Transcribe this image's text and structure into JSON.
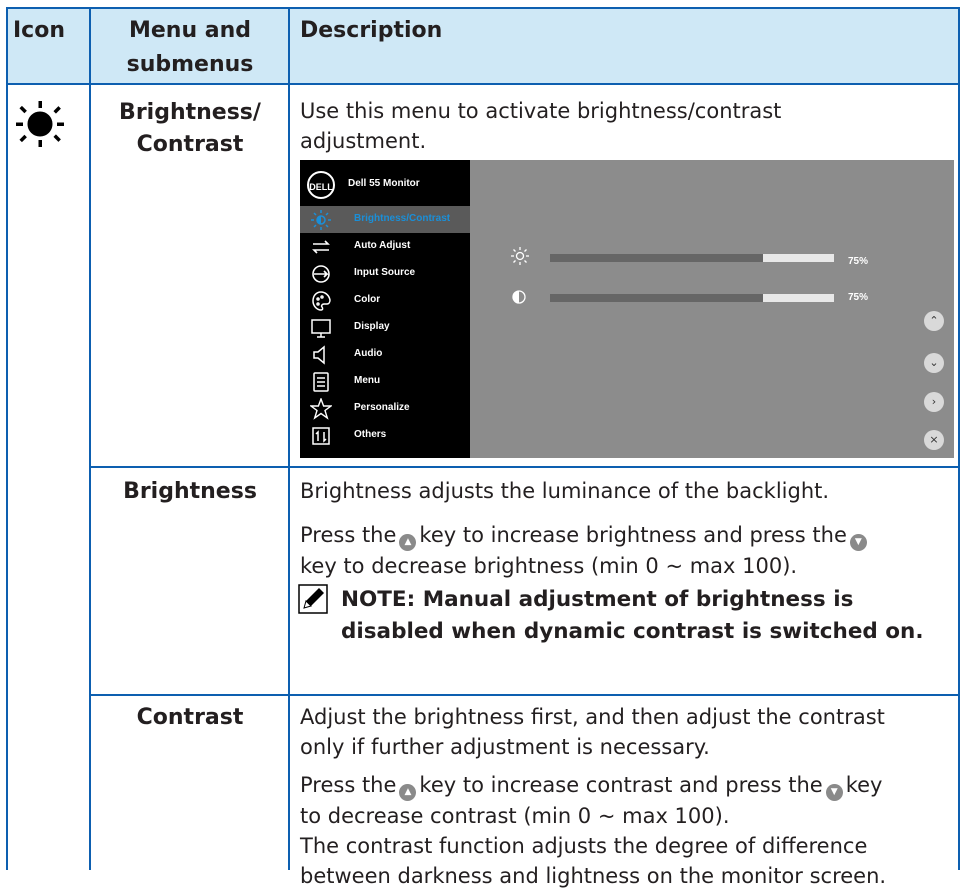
{
  "table": {
    "headers": {
      "icon": "Icon",
      "menu": "Menu and submenus",
      "menu_line1": "Menu and",
      "menu_line2": "submenus",
      "description": "Description"
    },
    "rows": [
      {
        "submenu_line1": "Brightness/",
        "submenu_line2": "Contrast",
        "description_line1": "Use this menu to activate brightness/contrast",
        "description_line2": "adjustment."
      },
      {
        "submenu": "Brightness",
        "para1": "Brightness adjusts the luminance of the backlight.",
        "para2_a": "Press the",
        "para2_b": "key to increase brightness and press the",
        "para2_c": "key to decrease brightness (min 0 ~ max 100).",
        "note_line1": "NOTE: Manual adjustment of brightness is",
        "note_line2": "disabled when dynamic contrast is switched on."
      },
      {
        "submenu": "Contrast",
        "para1_line1": "Adjust the brightness first, and then adjust the contrast",
        "para1_line2": "only if further adjustment is necessary.",
        "para2_a": "Press the",
        "para2_b": "key to increase contrast and press the",
        "para2_c": "key",
        "para2_line2": "to decrease contrast (min 0 ~ max 100).",
        "para3_line1": "The contrast function adjusts the degree of difference",
        "para3_line2": "between darkness and lightness on the monitor screen."
      }
    ]
  },
  "osd": {
    "logo": "DELL",
    "title": "Dell 55 Monitor",
    "menu_items": [
      {
        "label": "Brightness/Contrast",
        "icon": "sun-icon",
        "selected": true
      },
      {
        "label": "Auto Adjust",
        "icon": "auto-adjust-icon"
      },
      {
        "label": "Input Source",
        "icon": "input-source-icon"
      },
      {
        "label": "Color",
        "icon": "color-palette-icon"
      },
      {
        "label": "Display",
        "icon": "display-icon"
      },
      {
        "label": "Audio",
        "icon": "speaker-icon"
      },
      {
        "label": "Menu",
        "icon": "menu-doc-icon"
      },
      {
        "label": "Personalize",
        "icon": "star-icon"
      },
      {
        "label": "Others",
        "icon": "others-icon"
      }
    ],
    "brightness": {
      "value_text": "75%",
      "level": 0.75
    },
    "contrast": {
      "value_text": "75%",
      "level": 0.75
    },
    "buttons": [
      "up",
      "down",
      "right",
      "close"
    ],
    "colors": {
      "panel": "#8c8c8c",
      "sidebar": "#000000",
      "accent": "#1a8fd8"
    }
  },
  "colors": {
    "header_bg": "#cfe8f6",
    "rule": "#0d5fb0"
  }
}
